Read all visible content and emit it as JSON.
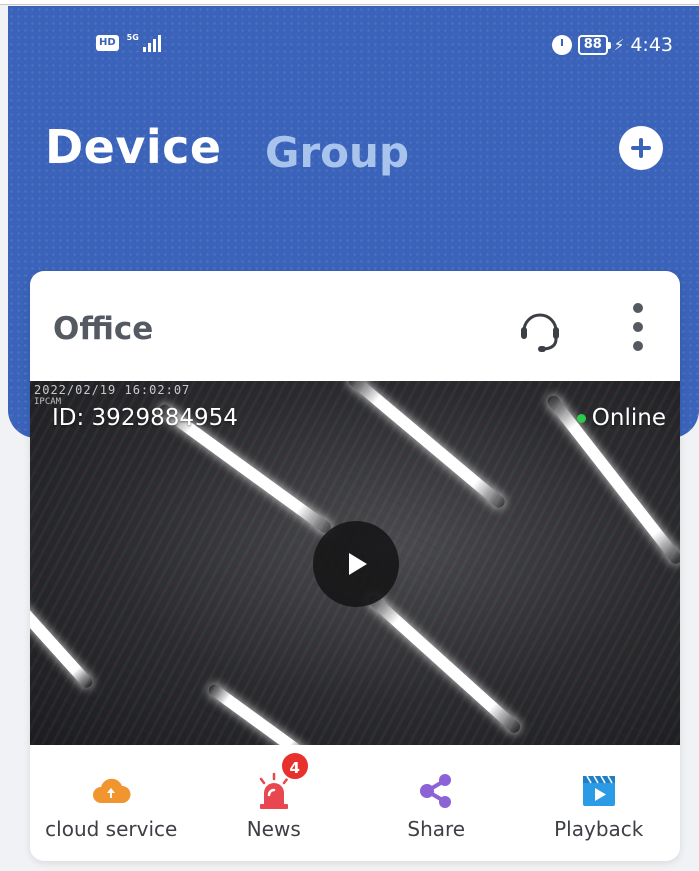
{
  "status_bar": {
    "hd_label": "HD",
    "network_label": "5G",
    "battery": "88",
    "time": "4:43"
  },
  "header": {
    "tab_device": "Device",
    "tab_group": "Group"
  },
  "device_card": {
    "name": "Office",
    "timestamp": "2022/02/19 16:02:07",
    "camera_tag": "IPCAM",
    "device_id": "ID: 3929884954",
    "status": "Online"
  },
  "actions": [
    {
      "label": "cloud service",
      "icon": "cloud-icon",
      "color": "#f0952f"
    },
    {
      "label": "News",
      "icon": "alarm-light-icon",
      "color": "#e8474f",
      "badge": "4"
    },
    {
      "label": "Share",
      "icon": "share-icon",
      "color": "#8c62d6"
    },
    {
      "label": "Playback",
      "icon": "video-file-icon",
      "color": "#2b9be6"
    }
  ],
  "colors": {
    "header_blue": "#3a63b9",
    "group_tab_inactive": "#a8c4ec",
    "online_green": "#2ec84a",
    "badge_red": "#e8302c"
  }
}
